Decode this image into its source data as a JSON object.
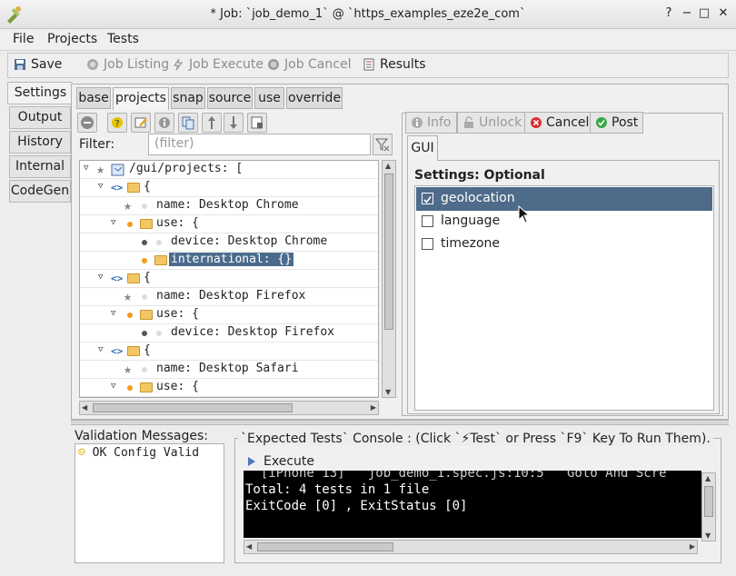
{
  "window": {
    "title": "* Job: `job_demo_1` @ `https_examples_eze2e_com`"
  },
  "menu": [
    "File",
    "Projects",
    "Tests"
  ],
  "toolbar": {
    "save": "Save",
    "job_listing": "Job Listing",
    "job_execute": "Job Execute",
    "job_cancel": "Job Cancel",
    "results": "Results"
  },
  "side_tabs": [
    "Settings",
    "Output",
    "History",
    "Internal",
    "CodeGen"
  ],
  "config_tabs": [
    "base",
    "projects",
    "snap",
    "source",
    "use",
    "override"
  ],
  "filter": {
    "label": "Filter:",
    "placeholder": "(filter)"
  },
  "tree": [
    {
      "text": "/gui/projects: ["
    },
    {
      "text": "{"
    },
    {
      "text": "name: Desktop Chrome"
    },
    {
      "text": "use: {"
    },
    {
      "text": "device: Desktop Chrome"
    },
    {
      "text": "international: {}"
    },
    {
      "text": "{"
    },
    {
      "text": "name: Desktop Firefox"
    },
    {
      "text": "use: {"
    },
    {
      "text": "device: Desktop Firefox"
    },
    {
      "text": "{"
    },
    {
      "text": "name: Desktop Safari"
    },
    {
      "text": "use: {"
    }
  ],
  "detail_buttons": {
    "info": "Info",
    "unlock": "Unlock",
    "cancel": "Cancel",
    "post": "Post"
  },
  "detail_tab": "GUI",
  "settings": {
    "title": "Settings: Optional",
    "options": [
      {
        "label": "geolocation",
        "checked": true
      },
      {
        "label": "language",
        "checked": false
      },
      {
        "label": "timezone",
        "checked": false
      }
    ]
  },
  "validation": {
    "title": "Validation Messages:",
    "message": "OK Config Valid"
  },
  "console": {
    "title": "`Expected Tests` Console : (Click `⚡Test` or Press `F9` Key To Run Them).",
    "execute": "Execute",
    "lines": [
      "  [iPhone 13]   job_demo_1.spec.js:10:5   Goto And Scre",
      "Total: 4 tests in 1 file",
      "ExitCode [0] , ExitStatus [0]"
    ]
  }
}
